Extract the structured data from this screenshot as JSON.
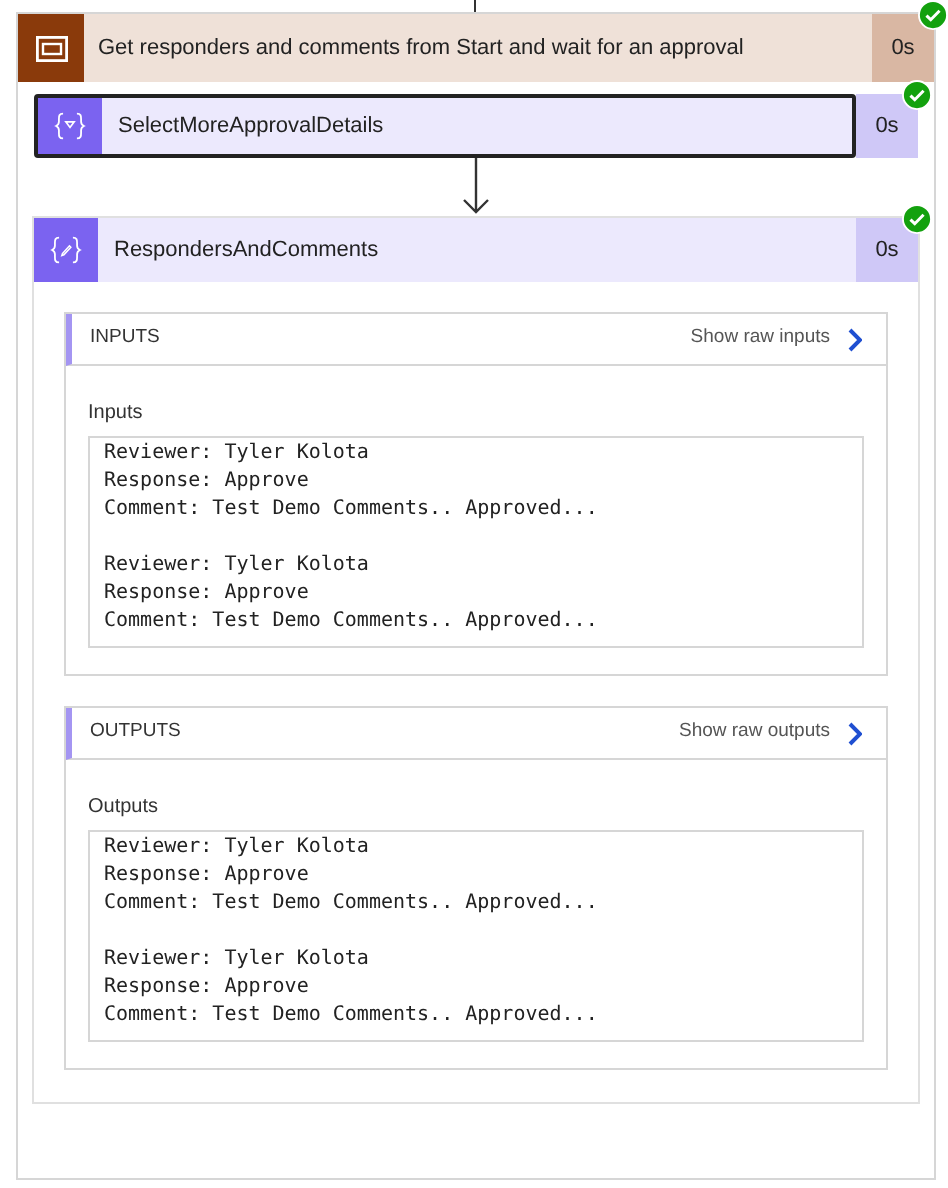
{
  "scope": {
    "title": "Get responders and comments from Start and wait for an approval",
    "duration": "0s",
    "succeeded": true,
    "actions": [
      {
        "kind": "select",
        "name": "SelectMoreApprovalDetails",
        "duration": "0s",
        "selected": true,
        "succeeded": true,
        "expanded": false
      },
      {
        "kind": "compose",
        "name": "RespondersAndComments",
        "duration": "0s",
        "selected": false,
        "succeeded": true,
        "expanded": true,
        "sections": [
          {
            "heading": "INPUTS",
            "raw_link": "Show raw inputs",
            "label": "Inputs",
            "entries": [
              {
                "lines": [
                  "Reviewer: Tyler Kolota",
                  "Response: Approve",
                  "Comment: Test Demo Comments.. Approved..."
                ]
              },
              {
                "lines": [
                  "Reviewer: Tyler Kolota",
                  "Response: Approve",
                  "Comment: Test Demo Comments.. Approved..."
                ]
              }
            ]
          },
          {
            "heading": "OUTPUTS",
            "raw_link": "Show raw outputs",
            "label": "Outputs",
            "entries": [
              {
                "lines": [
                  "Reviewer: Tyler Kolota",
                  "Response: Approve",
                  "Comment: Test Demo Comments.. Approved..."
                ]
              },
              {
                "lines": [
                  "Reviewer: Tyler Kolota",
                  "Response: Approve",
                  "Comment: Test Demo Comments.. Approved..."
                ]
              }
            ]
          }
        ]
      }
    ]
  }
}
